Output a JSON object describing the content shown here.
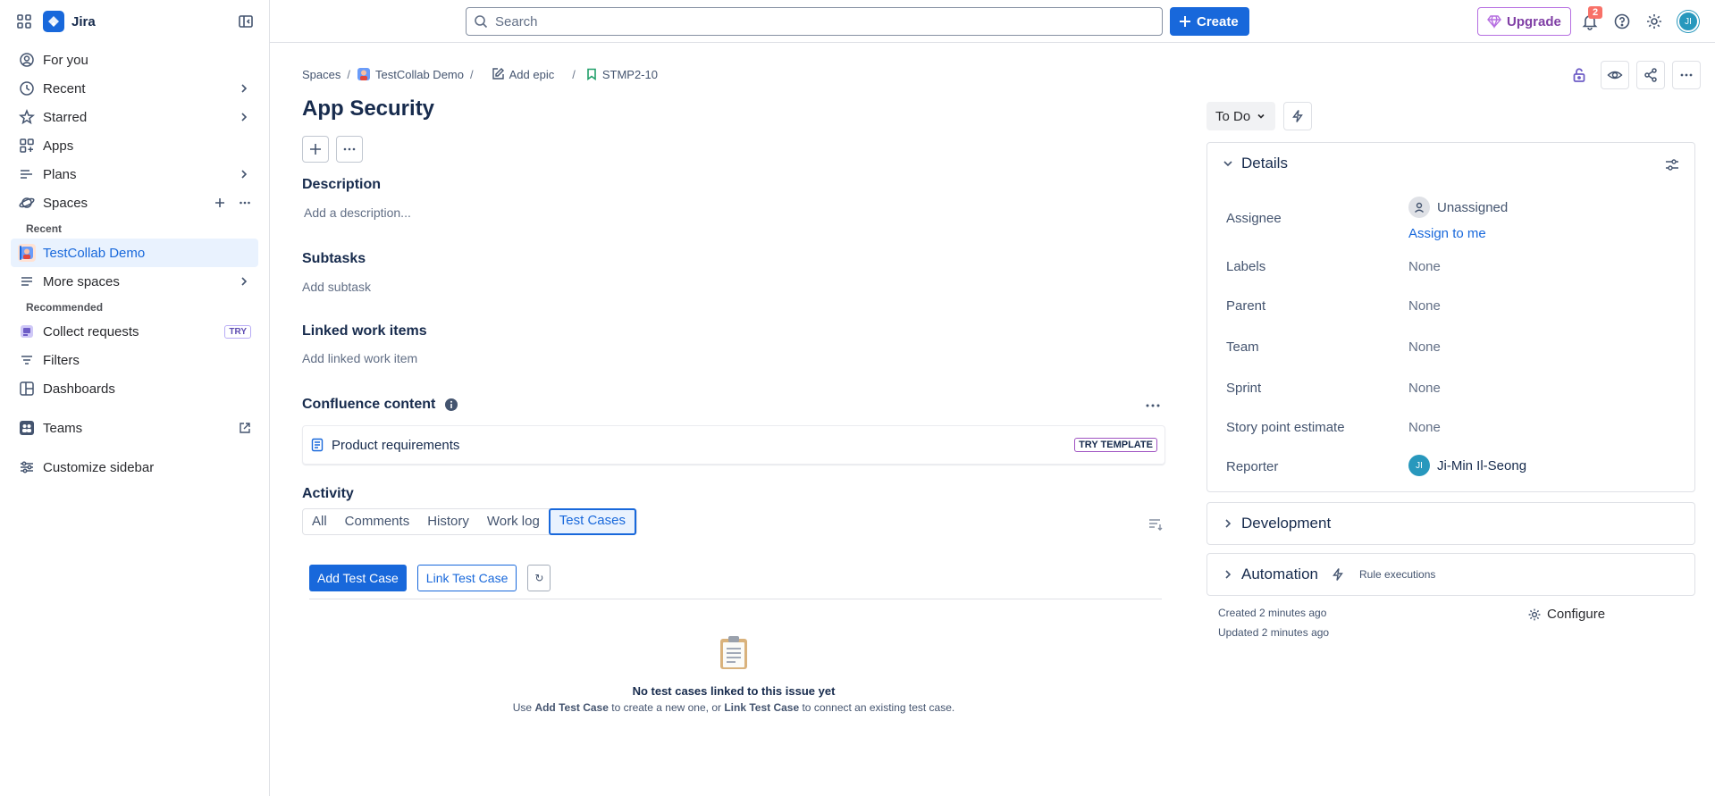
{
  "app": {
    "name": "Jira"
  },
  "topbar": {
    "search_placeholder": "Search",
    "create_label": "Create",
    "upgrade_label": "Upgrade",
    "notification_count": "2",
    "user_initials": "JI"
  },
  "sidebar": {
    "items": [
      {
        "label": "For you"
      },
      {
        "label": "Recent"
      },
      {
        "label": "Starred"
      },
      {
        "label": "Apps"
      },
      {
        "label": "Plans"
      },
      {
        "label": "Spaces"
      }
    ],
    "recent_heading": "Recent",
    "recent_project": "TestCollab Demo",
    "more_spaces": "More spaces",
    "recommended_heading": "Recommended",
    "collect_requests": "Collect requests",
    "try_badge": "TRY",
    "filters": "Filters",
    "dashboards": "Dashboards",
    "teams": "Teams",
    "customize": "Customize sidebar"
  },
  "breadcrumb": {
    "spaces": "Spaces",
    "project": "TestCollab Demo",
    "add_epic": "Add epic",
    "issue_key": "STMP2-10"
  },
  "issue": {
    "title": "App Security",
    "description_heading": "Description",
    "description_placeholder": "Add a description...",
    "subtasks_heading": "Subtasks",
    "add_subtask": "Add subtask",
    "linked_heading": "Linked work items",
    "add_linked": "Add linked work item",
    "confluence_heading": "Confluence content",
    "product_requirements": "Product requirements",
    "try_template": "TRY TEMPLATE"
  },
  "activity": {
    "heading": "Activity",
    "tabs": [
      {
        "label": "All"
      },
      {
        "label": "Comments"
      },
      {
        "label": "History"
      },
      {
        "label": "Work log"
      },
      {
        "label": "Test Cases"
      }
    ],
    "add_test_case": "Add Test Case",
    "link_test_case": "Link Test Case",
    "refresh": "↻",
    "empty_title": "No test cases linked to this issue yet",
    "empty_pre": "Use ",
    "empty_add": "Add Test Case",
    "empty_mid": " to create a new one, or ",
    "empty_link": "Link Test Case",
    "empty_post": " to connect an existing test case."
  },
  "details": {
    "status": "To Do",
    "heading": "Details",
    "fields": {
      "assignee_label": "Assignee",
      "assignee_value": "Unassigned",
      "assign_to_me": "Assign to me",
      "labels_label": "Labels",
      "labels_value": "None",
      "parent_label": "Parent",
      "parent_value": "None",
      "team_label": "Team",
      "team_value": "None",
      "sprint_label": "Sprint",
      "sprint_value": "None",
      "story_points_label": "Story point estimate",
      "story_points_value": "None",
      "reporter_label": "Reporter",
      "reporter_value": "Ji-Min Il-Seong",
      "reporter_initials": "JI"
    },
    "development": "Development",
    "automation": "Automation",
    "rule_executions": "Rule executions",
    "created": "Created 2 minutes ago",
    "updated": "Updated 2 minutes ago",
    "configure": "Configure"
  },
  "colors": {
    "brand": "#1868DB",
    "upgrade": "#803FA5",
    "badge": "#F87168"
  }
}
